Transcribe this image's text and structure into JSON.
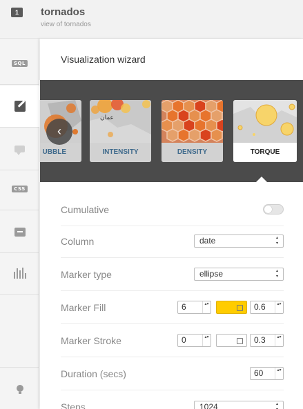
{
  "header": {
    "layer_number": "1",
    "title": "tornados",
    "subtitle": "view of tornados"
  },
  "sidebar": {
    "items": [
      {
        "name": "sql",
        "label": "SQL"
      },
      {
        "name": "wizard",
        "icon": "pencil-icon"
      },
      {
        "name": "infowindow",
        "icon": "speech-bubble-icon"
      },
      {
        "name": "css",
        "label": "CSS"
      },
      {
        "name": "legend",
        "icon": "legend-icon"
      },
      {
        "name": "filters",
        "icon": "bar-chart-icon"
      },
      {
        "name": "tips",
        "icon": "lightbulb-icon"
      }
    ]
  },
  "panel": {
    "title": "Visualization wizard"
  },
  "carousel": {
    "cards": [
      {
        "label": "UBBLE"
      },
      {
        "label": "INTENSITY"
      },
      {
        "label": "DENSITY"
      },
      {
        "label": "TORQUE",
        "selected": true
      }
    ],
    "intensity_map_text": "عمان"
  },
  "form": {
    "cumulative": {
      "label": "Cumulative",
      "on": false
    },
    "column": {
      "label": "Column",
      "value": "date"
    },
    "marker_type": {
      "label": "Marker type",
      "value": "ellipse"
    },
    "marker_fill": {
      "label": "Marker Fill",
      "size": "6",
      "color": "#FFCC00",
      "opacity": "0.6"
    },
    "marker_stroke": {
      "label": "Marker Stroke",
      "width": "0",
      "color": "#FFFFFF",
      "opacity": "0.3"
    },
    "duration": {
      "label": "Duration (secs)",
      "value": "60"
    },
    "steps": {
      "label": "Steps",
      "value": "1024"
    }
  },
  "colors": {
    "fill_swatch": "#FFCC00",
    "stroke_swatch": "#FFFFFF",
    "link_blue": "#3f6a8c",
    "carousel_bg": "#4b4b4b"
  }
}
